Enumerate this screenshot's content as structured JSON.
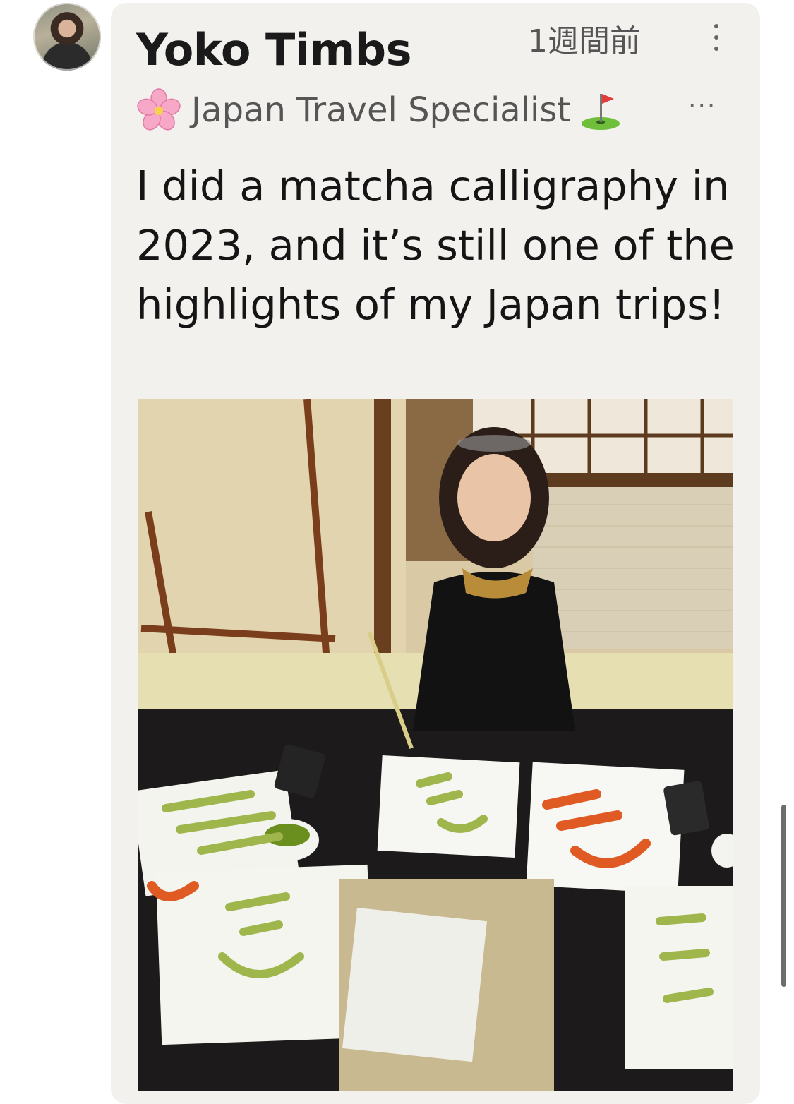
{
  "post": {
    "author": "Yoko Timbs",
    "timestamp": "1週間前",
    "subtitle": "Japan Travel Specialist",
    "more_subtitle": "···",
    "body": "I did a matcha calligraphy in 2023, and it’s still one of the highlights of my Japan trips!",
    "icons": {
      "avatar": "profile-photo",
      "blossom": "cherry-blossom-icon",
      "flag": "golf-flag-icon",
      "menu": "kebab-menu-icon"
    }
  },
  "colors": {
    "card_bg": "#f2f1ed",
    "text": "#151515",
    "muted": "#555555"
  }
}
